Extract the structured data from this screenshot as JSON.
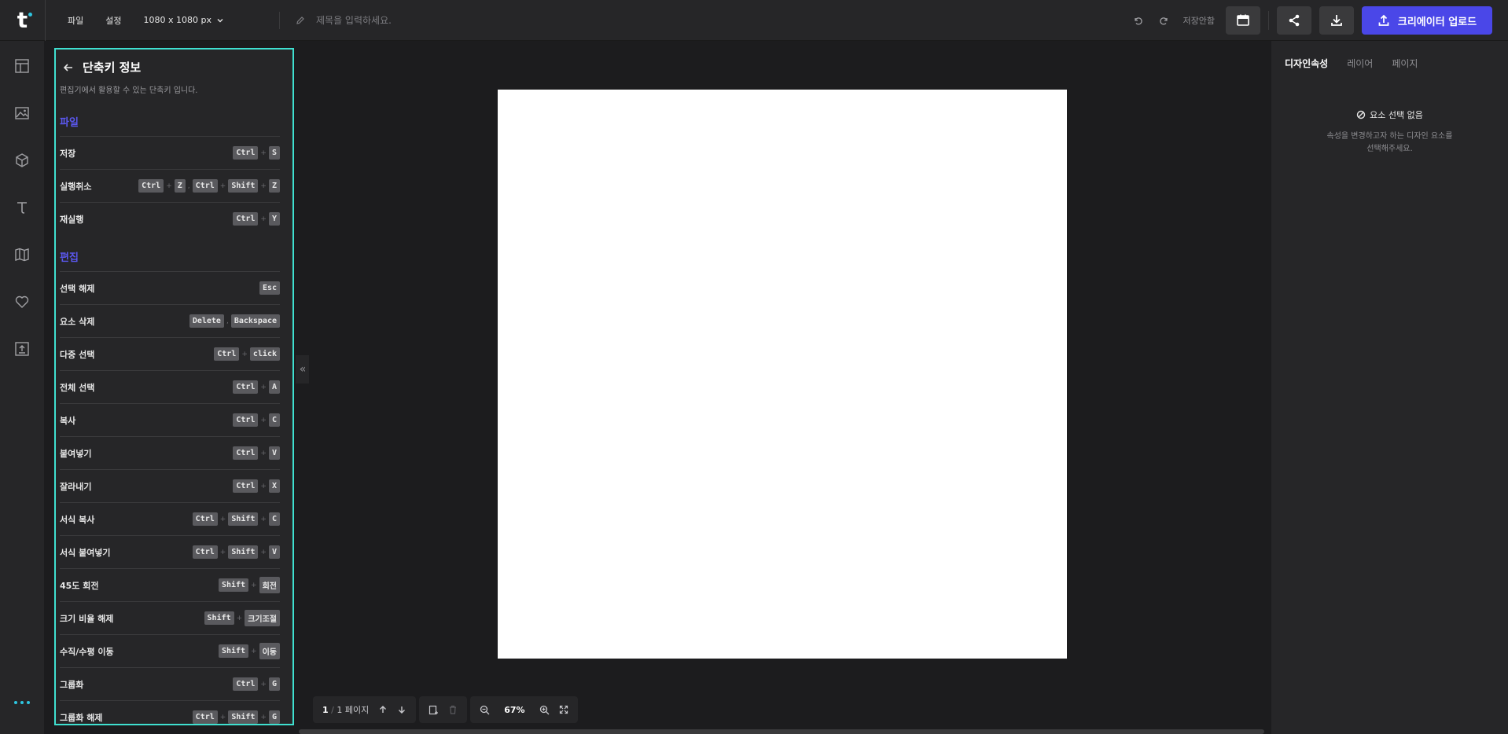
{
  "topbar": {
    "logo_letter": "t",
    "menu": [
      "파일",
      "설정"
    ],
    "size_select": "1080 x 1080 px",
    "title_placeholder": "제목을 입력하세요.",
    "save_status": "저장안함",
    "upload_label": "크리에이터 업로드",
    "accent": "#4a47e8"
  },
  "leftbar": {
    "icons": [
      "template-icon",
      "image-icon",
      "element-icon",
      "text-icon",
      "background-icon",
      "favorite-icon",
      "upload-icon"
    ]
  },
  "shortcuts": {
    "title": "단축키 정보",
    "desc": "편집기에서 활용할 수 있는 단축키 입니다.",
    "sections": [
      {
        "name": "파일",
        "rows": [
          {
            "label": "저장",
            "keys": [
              [
                "Ctrl",
                "S"
              ]
            ]
          },
          {
            "label": "실행취소",
            "keys": [
              [
                "Ctrl",
                "Z"
              ],
              [
                "Ctrl",
                "Shift",
                "Z"
              ]
            ]
          },
          {
            "label": "재실행",
            "keys": [
              [
                "Ctrl",
                "Y"
              ]
            ]
          }
        ]
      },
      {
        "name": "편집",
        "rows": [
          {
            "label": "선택 해제",
            "keys": [
              [
                "Esc"
              ]
            ]
          },
          {
            "label": "요소 삭제",
            "keys": [
              [
                "Delete"
              ],
              [
                "Backspace"
              ]
            ]
          },
          {
            "label": "다중 선택",
            "keys": [
              [
                "Ctrl",
                "click"
              ]
            ]
          },
          {
            "label": "전체 선택",
            "keys": [
              [
                "Ctrl",
                "A"
              ]
            ]
          },
          {
            "label": "복사",
            "keys": [
              [
                "Ctrl",
                "C"
              ]
            ]
          },
          {
            "label": "붙여넣기",
            "keys": [
              [
                "Ctrl",
                "V"
              ]
            ]
          },
          {
            "label": "잘라내기",
            "keys": [
              [
                "Ctrl",
                "X"
              ]
            ]
          },
          {
            "label": "서식 복사",
            "keys": [
              [
                "Ctrl",
                "Shift",
                "C"
              ]
            ]
          },
          {
            "label": "서식 붙여넣기",
            "keys": [
              [
                "Ctrl",
                "Shift",
                "V"
              ]
            ]
          },
          {
            "label": "45도 회전",
            "keys": [
              [
                "Shift",
                "회전"
              ]
            ]
          },
          {
            "label": "크기 비율 해제",
            "keys": [
              [
                "Shift",
                "크기조절"
              ]
            ]
          },
          {
            "label": "수직/수평 이동",
            "keys": [
              [
                "Shift",
                "이동"
              ]
            ]
          },
          {
            "label": "그룹화",
            "keys": [
              [
                "Ctrl",
                "G"
              ]
            ]
          },
          {
            "label": "그룹화 해제",
            "keys": [
              [
                "Ctrl",
                "Shift",
                "G"
              ]
            ]
          }
        ]
      }
    ]
  },
  "bottom": {
    "page_current": "1",
    "page_sep": "/",
    "page_total": "1",
    "page_label": "페이지",
    "zoom": "67%"
  },
  "rightpanel": {
    "tabs": [
      "디자인속성",
      "레이어",
      "페이지"
    ],
    "empty_title": "요소 선택 없음",
    "empty_desc_1": "속성을 변경하고자 하는 디자인 요소를",
    "empty_desc_2": "선택해주세요."
  }
}
